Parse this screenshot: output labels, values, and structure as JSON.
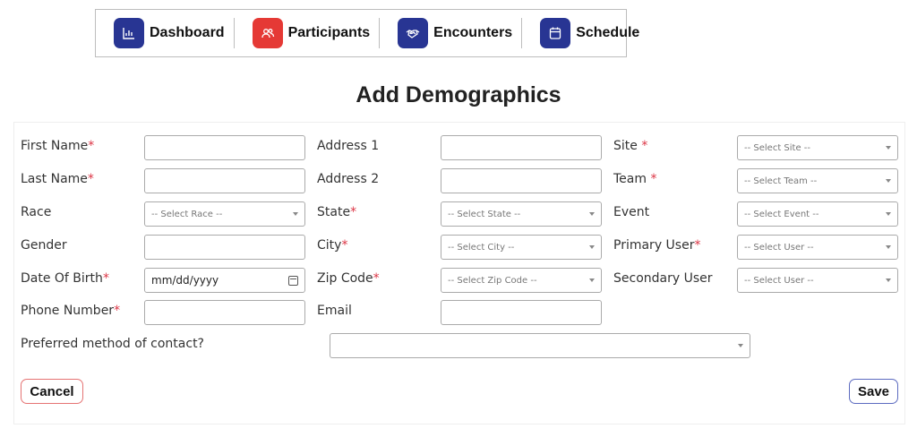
{
  "nav": {
    "items": [
      {
        "label": "Dashboard",
        "icon": "bar-chart-icon",
        "color": "#283593"
      },
      {
        "label": "Participants",
        "icon": "users-icon",
        "color": "#e53935"
      },
      {
        "label": "Encounters",
        "icon": "handshake-icon",
        "color": "#283593"
      },
      {
        "label": "Schedule",
        "icon": "calendar-icon",
        "color": "#283593"
      }
    ]
  },
  "page": {
    "title": "Add Demographics"
  },
  "form": {
    "required_marker": "*",
    "first_name": {
      "label": "First Name",
      "value": ""
    },
    "last_name": {
      "label": "Last Name",
      "value": ""
    },
    "race": {
      "label": "Race",
      "placeholder": "-- Select Race --"
    },
    "gender": {
      "label": "Gender",
      "value": ""
    },
    "dob": {
      "label": "Date Of Birth",
      "placeholder": "mm/dd/yyyy"
    },
    "phone": {
      "label": "Phone Number",
      "value": ""
    },
    "address1": {
      "label": "Address 1",
      "value": ""
    },
    "address2": {
      "label": "Address 2",
      "value": ""
    },
    "state": {
      "label": "State",
      "placeholder": "-- Select State --"
    },
    "city": {
      "label": "City",
      "placeholder": "-- Select City --"
    },
    "zip": {
      "label": "Zip Code",
      "placeholder": "-- Select Zip Code --"
    },
    "email": {
      "label": "Email",
      "value": ""
    },
    "site": {
      "label": "Site",
      "placeholder": "-- Select Site --"
    },
    "team": {
      "label": "Team",
      "placeholder": "-- Select Team --"
    },
    "event": {
      "label": "Event",
      "placeholder": "-- Select Event --"
    },
    "primary_user": {
      "label": "Primary User",
      "placeholder": "-- Select User --"
    },
    "secondary_user": {
      "label": "Secondary User",
      "placeholder": "-- Select User --"
    },
    "contact_method": {
      "label": "Preferred method of contact?",
      "value": ""
    }
  },
  "actions": {
    "cancel_label": "Cancel",
    "save_label": "Save",
    "cancel_border": "#e57373",
    "save_border": "#5c6bc0"
  }
}
